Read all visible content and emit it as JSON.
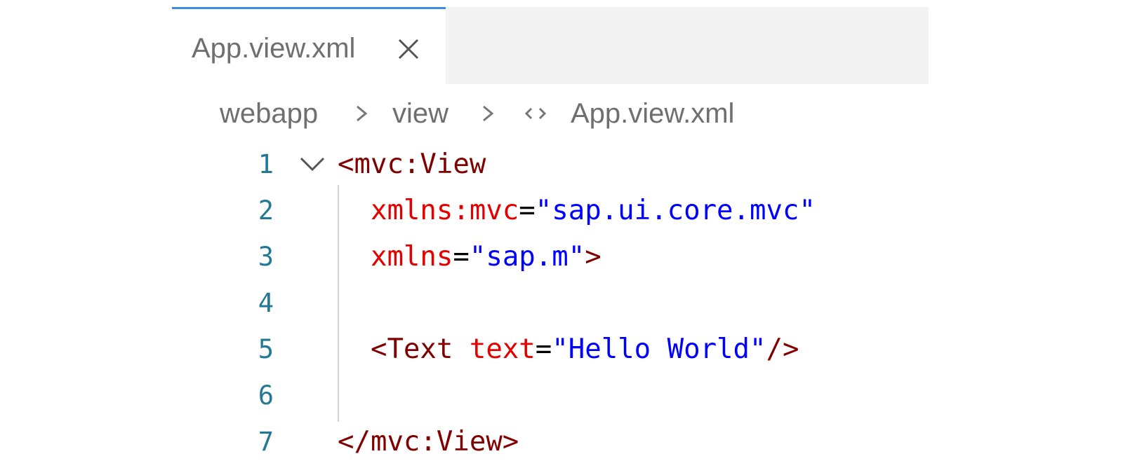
{
  "tab": {
    "label": "App.view.xml",
    "close_icon": "close-icon"
  },
  "breadcrumb": {
    "items": [
      "webapp",
      "view",
      "App.view.xml"
    ],
    "file_icon": "xml-code-icon"
  },
  "editor": {
    "lines": [
      {
        "number": "1",
        "tokens": [
          {
            "text": "<mvc:View",
            "kind": "tag"
          }
        ]
      },
      {
        "number": "2",
        "tokens": [
          {
            "text": "  xmlns:mvc",
            "kind": "attr"
          },
          {
            "text": "=",
            "kind": "eq"
          },
          {
            "text": "\"sap.ui.core.mvc\"",
            "kind": "str"
          }
        ]
      },
      {
        "number": "3",
        "tokens": [
          {
            "text": "  xmlns",
            "kind": "attr"
          },
          {
            "text": "=",
            "kind": "eq"
          },
          {
            "text": "\"sap.m\"",
            "kind": "str"
          },
          {
            "text": ">",
            "kind": "tag"
          }
        ]
      },
      {
        "number": "4",
        "tokens": []
      },
      {
        "number": "5",
        "tokens": [
          {
            "text": "  <Text ",
            "kind": "tag"
          },
          {
            "text": "text",
            "kind": "attr"
          },
          {
            "text": "=",
            "kind": "eq"
          },
          {
            "text": "\"Hello World\"",
            "kind": "str"
          },
          {
            "text": "/>",
            "kind": "tag"
          }
        ]
      },
      {
        "number": "6",
        "tokens": []
      },
      {
        "number": "7",
        "tokens": [
          {
            "text": "</mvc:View>",
            "kind": "tag"
          }
        ]
      }
    ]
  },
  "colors": {
    "tag": "#800000",
    "attr": "#e50000",
    "string": "#0000ff",
    "line_number": "#237893",
    "active_tab_border": "#3c8ce6"
  }
}
